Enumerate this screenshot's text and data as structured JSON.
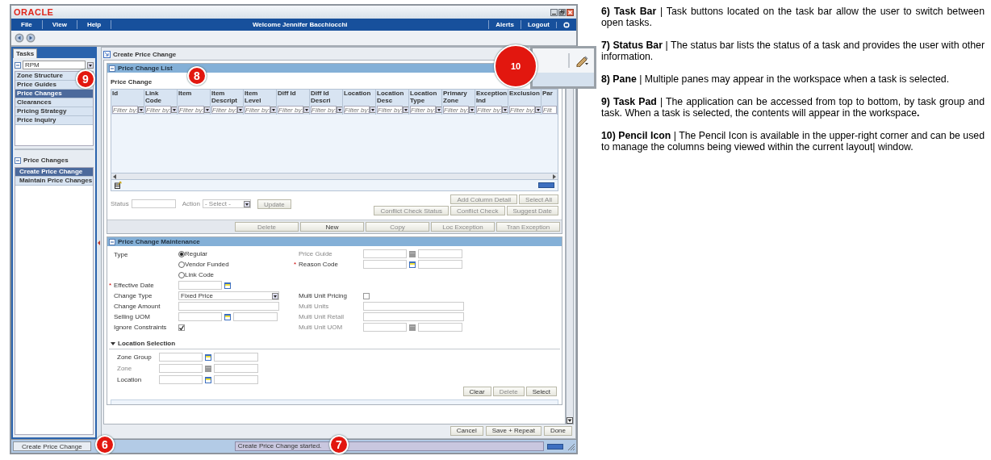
{
  "window": {
    "logo": "ORACLE"
  },
  "menu": {
    "items": [
      "File",
      "View",
      "Help"
    ],
    "welcome": "Welcome Jennifer Bacchiocchi",
    "right_items": [
      "Alerts",
      "Logout"
    ]
  },
  "task_pad": {
    "tab": "Tasks",
    "selector": "RPM",
    "groups": [
      {
        "label": "Zone Structure",
        "selected": false
      },
      {
        "label": "Price Guides",
        "selected": false
      },
      {
        "label": "Price Changes",
        "selected": true
      },
      {
        "label": "Clearances",
        "selected": false
      },
      {
        "label": "Pricing Strategy",
        "selected": false
      },
      {
        "label": "Price Inquiry",
        "selected": false
      }
    ],
    "section_title": "Price Changes",
    "tasks": [
      {
        "label": "Create Price Change",
        "selected": true
      },
      {
        "label": "Maintain Price Changes",
        "selected": false
      }
    ]
  },
  "workspace": {
    "title": "Create Price Change",
    "price_change_list": {
      "title": "Price Change List",
      "table_title": "Price Change",
      "columns": [
        {
          "label": "Id",
          "placeholder": "Filter by:"
        },
        {
          "label": "Link Code",
          "placeholder": "Filter by:"
        },
        {
          "label": "Item",
          "placeholder": "Filter by:"
        },
        {
          "label": "Item Descript",
          "placeholder": "Filter by:"
        },
        {
          "label": "Item Level",
          "placeholder": "Filter by:"
        },
        {
          "label": "Diff Id",
          "placeholder": "Filter by:"
        },
        {
          "label": "Diff Id Descri",
          "placeholder": "Filter by:"
        },
        {
          "label": "Location",
          "placeholder": "Filter by:"
        },
        {
          "label": "Location Desc",
          "placeholder": "Filter by:"
        },
        {
          "label": "Location Type",
          "placeholder": "Filter by:"
        },
        {
          "label": "Primary Zone",
          "placeholder": "Filter by:"
        },
        {
          "label": "Exception Ind",
          "placeholder": "Filter by:"
        },
        {
          "label": "Exclusion",
          "placeholder": "Filter by:"
        },
        {
          "label": "Par",
          "placeholder": "Filt"
        }
      ],
      "status_label": "Status",
      "action_label": "Action",
      "action_value": "- Select -",
      "action_buttons": [
        {
          "label": "Update",
          "disabled": true
        }
      ],
      "tool_rows": [
        [
          {
            "label": "Add Column Detail",
            "disabled": true
          },
          {
            "label": "Select All",
            "disabled": true
          }
        ],
        [
          {
            "label": "Conflict Check Status",
            "disabled": true
          },
          {
            "label": "Conflict Check",
            "disabled": true
          },
          {
            "label": "Suggest Date",
            "disabled": true
          }
        ]
      ],
      "bar_buttons": [
        {
          "label": "Delete",
          "disabled": true
        },
        {
          "label": "New",
          "disabled": false
        },
        {
          "label": "Copy",
          "disabled": true
        },
        {
          "label": "Loc Exception",
          "disabled": true
        },
        {
          "label": "Tran Exception",
          "disabled": true
        }
      ]
    },
    "maintenance": {
      "title": "Price Change Maintenance",
      "left_fields": [
        {
          "label": "Type",
          "kind": "radio",
          "options": [
            {
              "label": "Regular",
              "selected": true
            },
            {
              "label": "Vendor Funded",
              "selected": false
            },
            {
              "label": "Link Code",
              "selected": false
            }
          ]
        },
        {
          "label": "Effective Date",
          "kind": "date",
          "required_mark": "*"
        },
        {
          "label": "Change Type",
          "kind": "select",
          "value": "Fixed Price"
        },
        {
          "label": "Change Amount",
          "kind": "text"
        },
        {
          "label": "Selling UOM",
          "kind": "lookup"
        },
        {
          "label": "Ignore Constraints",
          "kind": "checkbox",
          "checked": true
        }
      ],
      "right_fields": [
        {
          "label": "Price Guide",
          "kind": "lookup",
          "disabled": true
        },
        {
          "label": "Reason Code",
          "kind": "lookup",
          "required_mark": "*"
        },
        {
          "label": "Multi Unit Pricing",
          "kind": "checkbox",
          "checked": false
        },
        {
          "label": "Multi Units",
          "kind": "text",
          "disabled": true
        },
        {
          "label": "Multi Unit Retail",
          "kind": "text",
          "disabled": true
        },
        {
          "label": "Multi Unit UOM",
          "kind": "lookup",
          "disabled": true
        }
      ]
    },
    "location_selection": {
      "title": "Location Selection",
      "expanded": true,
      "fields": [
        {
          "label": "Zone Group",
          "kind": "lookup"
        },
        {
          "label": "Zone",
          "kind": "lookup",
          "disabled": true
        },
        {
          "label": "Location",
          "kind": "lookup"
        }
      ],
      "buttons": [
        {
          "label": "Clear",
          "disabled": false
        },
        {
          "label": "Delete",
          "disabled": true
        },
        {
          "label": "Select",
          "disabled": false
        }
      ]
    },
    "footer_buttons": [
      {
        "label": "Cancel",
        "disabled": false
      },
      {
        "label": "Save + Repeat",
        "disabled": false
      },
      {
        "label": "Done",
        "disabled": false
      }
    ]
  },
  "task_bar": {
    "tasks": [
      {
        "label": "Create Price Change"
      }
    ]
  },
  "status_bar": {
    "message": "Create Price Change started."
  },
  "callouts": [
    "9",
    "8",
    "10",
    "6",
    "7"
  ],
  "notes": [
    "**6) Task Bar** | Task buttons located on the task bar allow the user to switch between open tasks.",
    "**7) Status Bar** | The status bar lists the status of a task and provides the user with other information.",
    "**8) Pane** | Multiple panes may appear in the workspace when a task is selected.",
    "**9) Task Pad** | The application can be accessed from top to bottom, by task group and task. When a task is selected, the contents will appear in the workspace**.**",
    "**10) Pencil Icon** | The Pencil Icon is available in the upper-right corner and can be used to manage the columns being viewed within the current layout| window."
  ]
}
